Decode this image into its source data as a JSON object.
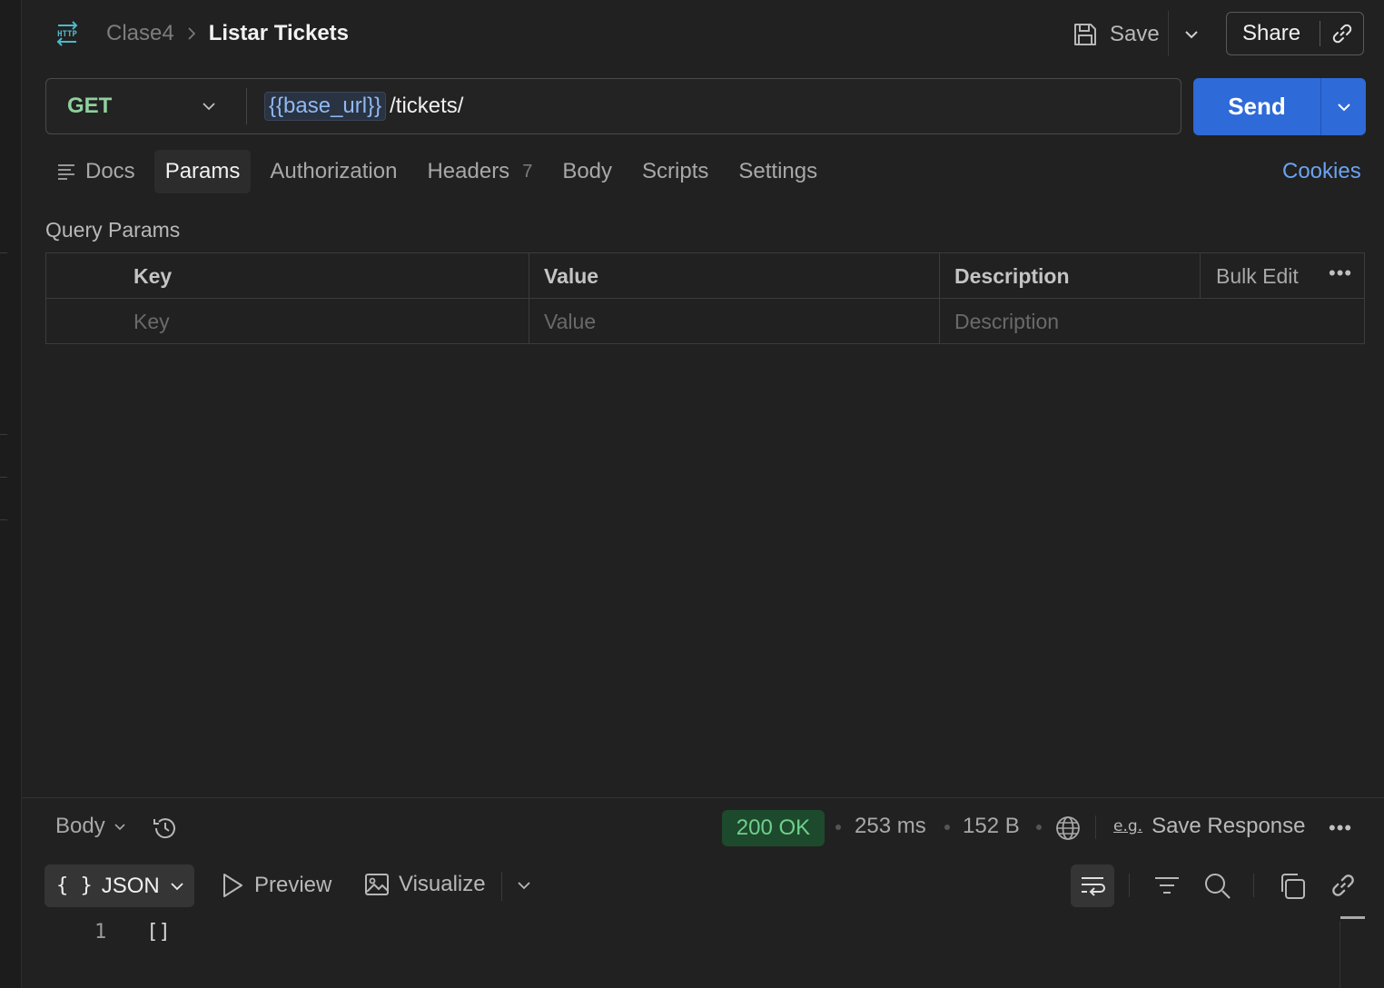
{
  "header": {
    "protocol_icon": "http-icon",
    "breadcrumb_parent": "Clase4",
    "breadcrumb_current": "Listar Tickets",
    "save_label": "Save",
    "share_label": "Share"
  },
  "request": {
    "method": "GET",
    "url_variable": "{{base_url}}",
    "url_path": "/tickets/",
    "send_label": "Send"
  },
  "tabs": [
    {
      "label": "Docs",
      "active": false
    },
    {
      "label": "Params",
      "active": true
    },
    {
      "label": "Authorization",
      "active": false
    },
    {
      "label": "Headers",
      "badge": "7",
      "active": false
    },
    {
      "label": "Body",
      "active": false
    },
    {
      "label": "Scripts",
      "active": false
    },
    {
      "label": "Settings",
      "active": false
    }
  ],
  "cookies_label": "Cookies",
  "query_params": {
    "title": "Query Params",
    "columns": [
      "Key",
      "Value",
      "Description"
    ],
    "bulk_edit_label": "Bulk Edit",
    "placeholders": [
      "Key",
      "Value",
      "Description"
    ]
  },
  "response": {
    "view_selector": "Body",
    "status": "200 OK",
    "time": "253 ms",
    "size": "152 B",
    "save_response_label": "Save Response",
    "eg_label": "e.g.",
    "format_label": "JSON",
    "format_braces": "{ }",
    "preview_label": "Preview",
    "visualize_label": "Visualize",
    "lines": [
      {
        "number": "1",
        "code": "[]"
      }
    ]
  },
  "colors": {
    "background": "#212121",
    "accent": "#2e6ad8",
    "method_get": "#8fd19e",
    "status_ok": "#6fd08c",
    "link": "#6ba3f0"
  }
}
